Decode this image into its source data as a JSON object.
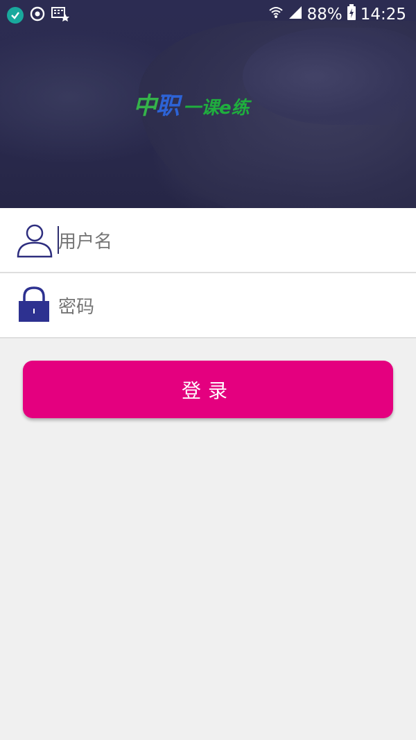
{
  "status_bar": {
    "battery": "88%",
    "time": "14:25",
    "icons": [
      "check-circle-icon",
      "sync-icon",
      "keyboard-star-icon",
      "wifi-icon",
      "signal-icon",
      "battery-charging-icon"
    ]
  },
  "logo": {
    "part1": "中",
    "part2": "职",
    "part3": "一课e练"
  },
  "form": {
    "username_placeholder": "用户名",
    "password_placeholder": "密码",
    "login_label": "登录"
  },
  "colors": {
    "hero_bg": "#2a2a4e",
    "accent": "#e4007f",
    "icon": "#2d2d7e",
    "background": "#f0f0f0"
  }
}
